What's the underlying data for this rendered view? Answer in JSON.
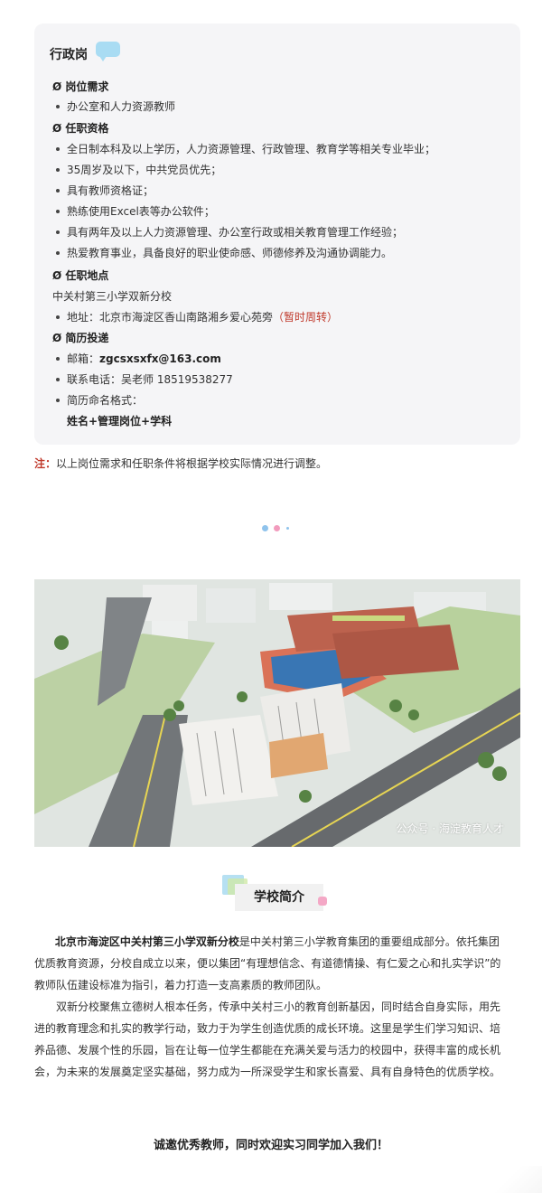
{
  "card": {
    "title": "行政岗",
    "sections": {
      "req_title": "Ø 岗位需求",
      "req_items": [
        "办公室和人力资源教师"
      ],
      "qual_title": "Ø 任职资格",
      "qual_items": [
        "全日制本科及以上学历，人力资源管理、行政管理、教育学等相关专业毕业；",
        "35周岁及以下，中共党员优先；",
        "具有教师资格证；",
        "熟练使用Excel表等办公软件；",
        "具有两年及以上人力资源管理、办公室行政或相关教育管理工作经验；",
        "热爱教育事业，具备良好的职业使命感、师德修养及沟通协调能力。"
      ],
      "loc_title": "Ø 任职地点",
      "loc_name": "中关村第三小学双新分校",
      "loc_addr_label": "地址：北京市海淀区香山南路湘乡爱心苑旁",
      "loc_addr_note": "（暂时周转）",
      "apply_title": "Ø 简历投递",
      "email_label": "邮箱：",
      "email": "zgcsxsxfx@163.com",
      "phone": "联系电话：吴老师 18519538277",
      "naming_label": "简历命名格式：",
      "naming_format": "姓名+管理岗位+学科"
    }
  },
  "note": {
    "label": "注：",
    "text": "以上岗位需求和任职条件将根据学校实际情况进行调整。"
  },
  "watermark": "公众号 · 海淀教育人才",
  "heading": "学校简介",
  "intro": {
    "p1_bold": "北京市海淀区中关村第三小学双新分校",
    "p1_rows": [
      "是中关村第三小学教育集团的重要组成部分。依托集团",
      "优质教育资源，分校自成立以来，便以集团“有理想信念、有道德情操、有仁爱之心和扎实学识”的",
      "教师队伍建设标准为指引，着力打造一支高素质的教师团队。"
    ],
    "p2_rows": [
      "双新分校聚焦立德树人根本任务，传承中关村三小的教育创新基因，同时结合自身实际，用先",
      "进的教育理念和扎实的教学行动，致力于为学生创造优质的成长环境。这里是学生们学习知识、培",
      "养品德、发展个性的乐园，旨在让每一位学生都能在充满关爱与活力的校园中，获得丰富的成长机",
      "会，为未来的发展奠定坚实基础，努力成为一所深受学生和家长喜爱、具有自身特色的优质学校。"
    ],
    "invite": "诚邀优秀教师，同时欢迎实习同学加入我们！"
  },
  "colors": {
    "card_bg": "#f5f5f7",
    "accent_red": "#c0392b",
    "bubble_blue": "#a9dcf3",
    "dot_blue": "#8fc3ec",
    "dot_pink": "#f29bbd"
  }
}
